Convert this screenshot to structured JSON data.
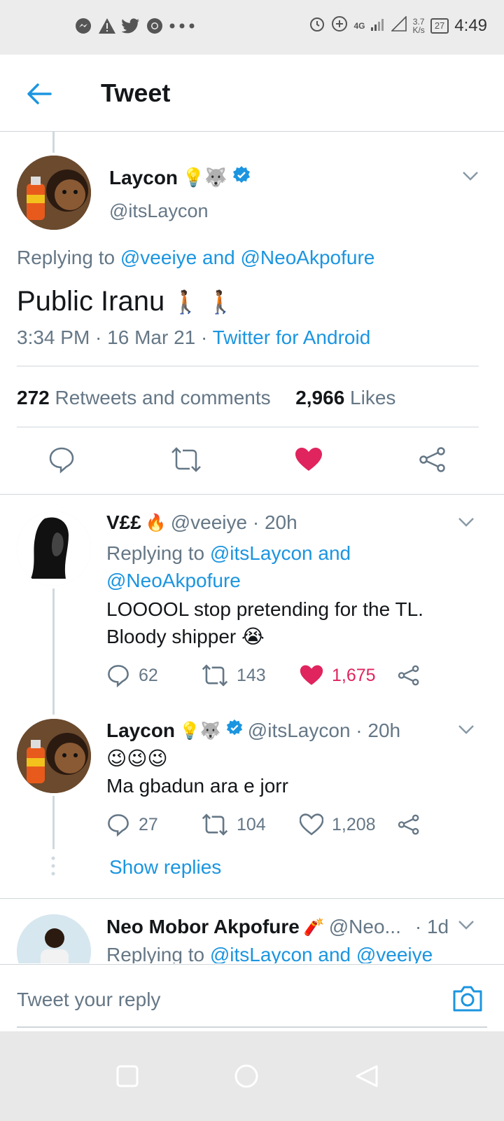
{
  "status_bar": {
    "time": "4:49",
    "battery": "27",
    "net_speed_value": "3.7",
    "net_speed_unit": "K/s",
    "network": "4G",
    "left_icons": [
      "messenger-icon",
      "alert-icon",
      "twitter-icon",
      "chrome-icon",
      "more-icon"
    ],
    "right_icons": [
      "alarm-icon",
      "data-saver-icon",
      "signal-icon",
      "wifi-icon"
    ]
  },
  "header": {
    "title": "Tweet"
  },
  "main_tweet": {
    "name": "Laycon",
    "name_emoji": "💡🐺",
    "handle": "@itsLaycon",
    "replying_prefix": "Replying to ",
    "replying_to": "@veeiye and @NeoAkpofure",
    "text": "Public Iranu",
    "text_emoji": "🚶🏾 🚶🏾",
    "time_date": "3:34 PM · 16 Mar 21 · ",
    "source": "Twitter for Android",
    "retweets_count": "272",
    "retweets_label": " Retweets and comments",
    "likes_count": "2,966",
    "likes_label": " Likes",
    "liked": true
  },
  "replies": [
    {
      "name": "V££",
      "name_emoji": "🔥",
      "handle": "@veeiye · 20h",
      "replying_prefix": "Replying to ",
      "replying_line1": "@itsLaycon and",
      "replying_line2": "@NeoAkpofure",
      "text_line1": "LOOOOL stop pretending for the TL.",
      "text_line2": "Bloody shipper",
      "text_emoji": "😭",
      "comments": "62",
      "retweets": "143",
      "likes": "1,675",
      "liked": true
    },
    {
      "name": "Laycon",
      "name_emoji": "💡🐺",
      "handle": "@itsLaycon · 20h",
      "emoji_line": "😉😉😉",
      "text_line1": "Ma gbadun ara e jorr",
      "comments": "27",
      "retweets": "104",
      "likes": "1,208",
      "liked": false,
      "show_replies": "Show replies"
    },
    {
      "name": "Neo Mobor Akpofure",
      "name_emoji": "🧨",
      "handle": "@Neo...",
      "time": "· 1d",
      "replying_prefix": "Replying to ",
      "replying_to": "@itsLaycon and @veeiye"
    }
  ],
  "composer": {
    "placeholder": "Tweet your reply"
  },
  "colors": {
    "accent": "#1b95e0",
    "like": "#e0245e",
    "secondary_text": "#657786",
    "divider": "#d0d6db"
  }
}
